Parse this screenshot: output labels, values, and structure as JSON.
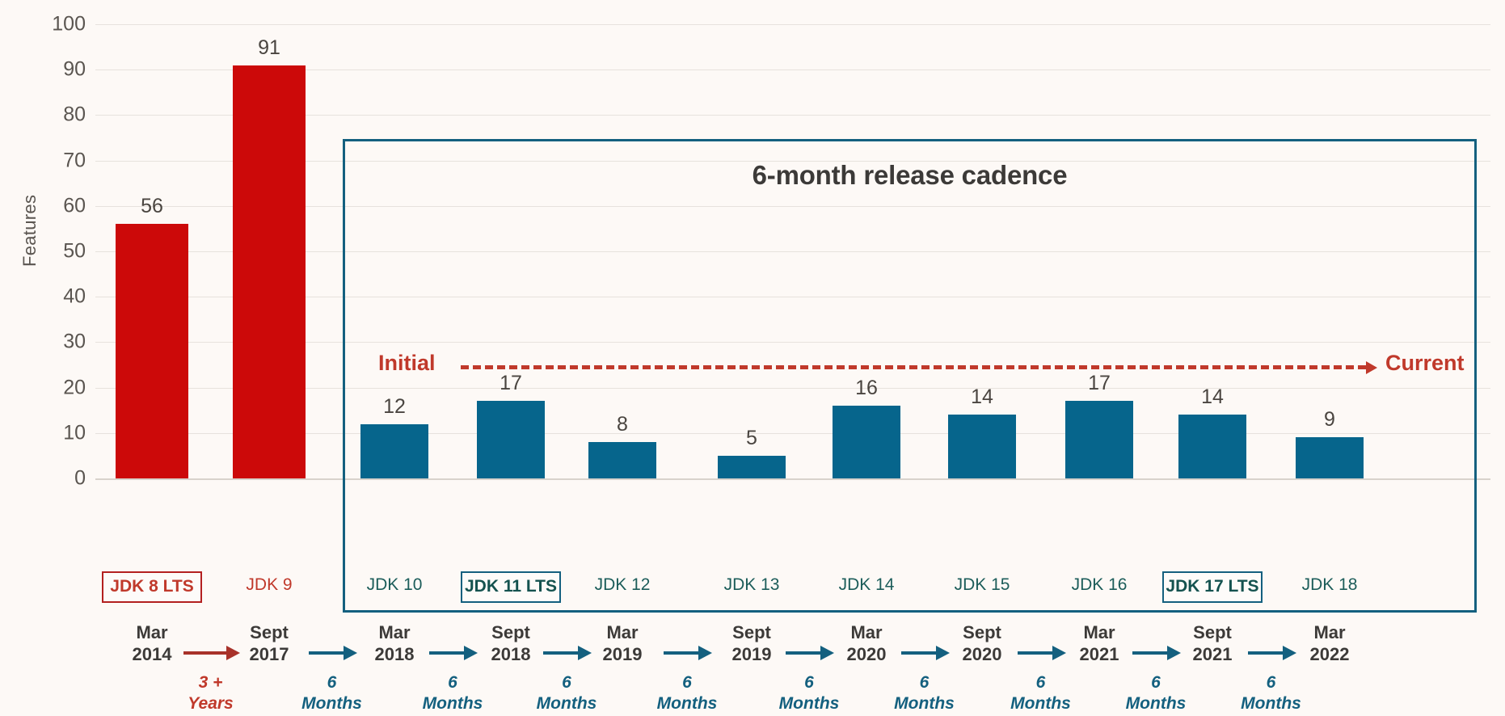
{
  "chart_data": {
    "type": "bar",
    "title": "6-month release cadence",
    "xlabel": "",
    "ylabel": "Features",
    "ylim": [
      0,
      100
    ],
    "yticks": [
      0,
      10,
      20,
      30,
      40,
      50,
      60,
      70,
      80,
      90,
      100
    ],
    "grid": true,
    "legend": null,
    "categories": [
      "JDK 8 LTS",
      "JDK 9",
      "JDK 10",
      "JDK 11 LTS",
      "JDK 12",
      "JDK 13",
      "JDK 14",
      "JDK 15",
      "JDK 16",
      "JDK 17 LTS",
      "JDK 18"
    ],
    "values": [
      56,
      91,
      12,
      17,
      8,
      5,
      16,
      14,
      17,
      14,
      9
    ],
    "bar_colors": [
      "#cc0909",
      "#cc0909",
      "#06658c",
      "#06658c",
      "#06658c",
      "#06658c",
      "#06658c",
      "#06658c",
      "#06658c",
      "#06658c",
      "#06658c"
    ],
    "release_dates": [
      "Mar 2014",
      "Sept 2017",
      "Mar 2018",
      "Sept 2018",
      "Mar 2019",
      "Sept 2019",
      "Mar 2020",
      "Sept 2020",
      "Mar 2021",
      "Sept 2021",
      "Mar 2022"
    ],
    "gaps": [
      "3 + Years",
      "6 Months",
      "6 Months",
      "6 Months",
      "6 Months",
      "6 Months",
      "6 Months",
      "6 Months",
      "6 Months",
      "6 Months"
    ],
    "annotations": [
      "Initial",
      "Current",
      "6-month release cadence"
    ]
  },
  "axis": {
    "ylabel": "Features",
    "ticks": [
      "100",
      "90",
      "80",
      "70",
      "60",
      "50",
      "40",
      "30",
      "20",
      "10",
      "0"
    ]
  },
  "cadence": {
    "title": "6-month release cadence"
  },
  "trend": {
    "initial": "Initial",
    "current": "Current"
  },
  "bars": [
    {
      "value": "56",
      "label": "JDK 8 LTS",
      "lts": true,
      "color": "red"
    },
    {
      "value": "91",
      "label": "JDK 9",
      "lts": false,
      "color": "red"
    },
    {
      "value": "12",
      "label": "JDK 10",
      "lts": false,
      "color": "blue"
    },
    {
      "value": "17",
      "label": "JDK 11 LTS",
      "lts": true,
      "color": "blue"
    },
    {
      "value": "8",
      "label": "JDK 12",
      "lts": false,
      "color": "blue"
    },
    {
      "value": "5",
      "label": "JDK 13",
      "lts": false,
      "color": "blue"
    },
    {
      "value": "16",
      "label": "JDK 14",
      "lts": false,
      "color": "blue"
    },
    {
      "value": "14",
      "label": "JDK 15",
      "lts": false,
      "color": "blue"
    },
    {
      "value": "17",
      "label": "JDK 16",
      "lts": false,
      "color": "blue"
    },
    {
      "value": "14",
      "label": "JDK 17 LTS",
      "lts": true,
      "color": "blue"
    },
    {
      "value": "9",
      "label": "JDK 18",
      "lts": false,
      "color": "blue"
    }
  ],
  "timeline": {
    "dates": [
      {
        "month": "Mar",
        "year": "2014"
      },
      {
        "month": "Sept",
        "year": "2017"
      },
      {
        "month": "Mar",
        "year": "2018"
      },
      {
        "month": "Sept",
        "year": "2018"
      },
      {
        "month": "Mar",
        "year": "2019"
      },
      {
        "month": "Sept",
        "year": "2019"
      },
      {
        "month": "Mar",
        "year": "2020"
      },
      {
        "month": "Sept",
        "year": "2020"
      },
      {
        "month": "Mar",
        "year": "2021"
      },
      {
        "month": "Sept",
        "year": "2021"
      },
      {
        "month": "Mar",
        "year": "2022"
      }
    ],
    "gaps": [
      {
        "num": "3 +",
        "unit": "Years",
        "color": "red"
      },
      {
        "num": "6",
        "unit": "Months",
        "color": "blue"
      },
      {
        "num": "6",
        "unit": "Months",
        "color": "blue"
      },
      {
        "num": "6",
        "unit": "Months",
        "color": "blue"
      },
      {
        "num": "6",
        "unit": "Months",
        "color": "blue"
      },
      {
        "num": "6",
        "unit": "Months",
        "color": "blue"
      },
      {
        "num": "6",
        "unit": "Months",
        "color": "blue"
      },
      {
        "num": "6",
        "unit": "Months",
        "color": "blue"
      },
      {
        "num": "6",
        "unit": "Months",
        "color": "blue"
      },
      {
        "num": "6",
        "unit": "Months",
        "color": "blue"
      }
    ]
  },
  "colors": {
    "red_bar": "#cc0909",
    "blue_bar": "#06658c",
    "accent_red": "#c0392b",
    "accent_blue": "#14607f",
    "background": "#fdf9f6",
    "grid": "#e7e2dd",
    "text": "#4a4540"
  }
}
